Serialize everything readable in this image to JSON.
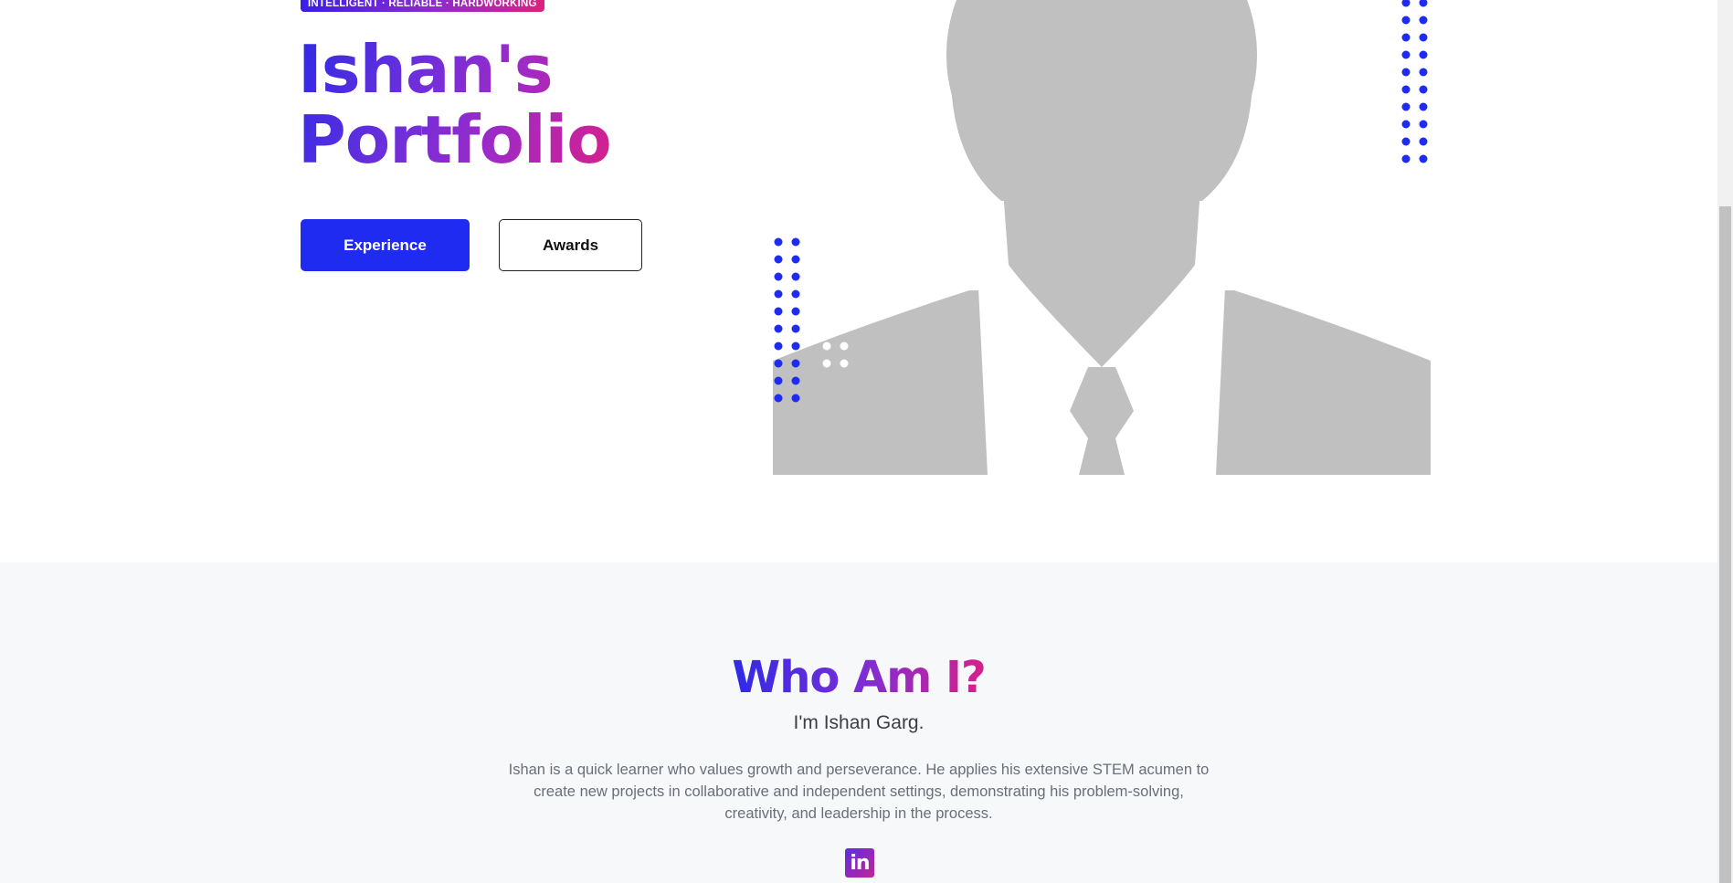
{
  "hero": {
    "tagline": "INTELLIGENT · RELIABLE · HARDWORKING",
    "title_line1": "Ishan's",
    "title_line2": "Portfolio",
    "buttons": {
      "experience_label": "Experience",
      "awards_label": "Awards"
    },
    "portrait_icon": "person-silhouette-placeholder"
  },
  "about": {
    "title": "Who Am I?",
    "subtitle": "I'm Ishan Garg.",
    "body": "Ishan is a quick learner who values growth and perseverance. He applies his extensive STEM acumen to create new projects in collaborative and independent settings, demonstrating his problem-solving, creativity, and leadership in the process.",
    "social_icon": "linkedin-icon",
    "social_glyph": "in"
  },
  "colors": {
    "accent_blue": "#1f2bf0",
    "gradient_start": "#2f2ae6",
    "gradient_end": "#d8208a",
    "section_bg": "#f7f8fa",
    "placeholder_gray": "#c0c0c0"
  }
}
